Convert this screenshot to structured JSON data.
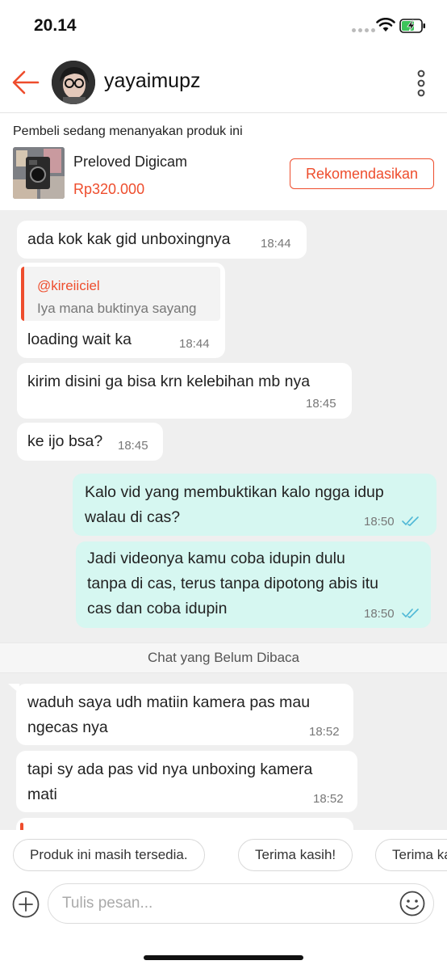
{
  "status_bar": {
    "time": "20.14"
  },
  "header": {
    "contact_name": "yayaimupz"
  },
  "product": {
    "notice": "Pembeli sedang menanyakan produk ini",
    "name": "Preloved Digicam",
    "price": "Rp320.000",
    "recommend_label": "Rekomendasikan"
  },
  "messages": [
    {
      "direction": "received",
      "text": "ada kok kak gid unboxingnya",
      "time": "18:44"
    },
    {
      "direction": "received",
      "quote_user": "@kireiiciel",
      "quote_text": "Iya mana buktinya sayang",
      "text": "loading wait ka",
      "time": "18:44"
    },
    {
      "direction": "received",
      "text": "kirim disini ga bisa krn kelebihan mb nya",
      "time": "18:45"
    },
    {
      "direction": "received",
      "text": "ke ijo bsa?",
      "time": "18:45"
    },
    {
      "direction": "sent",
      "lines": [
        "Kalo vid yang membuktikan kalo ngga idup",
        "walau di cas?"
      ],
      "time": "18:50",
      "read": true
    },
    {
      "direction": "sent",
      "lines": [
        "Jadi videonya kamu coba idupin dulu",
        "tanpa di cas, terus tanpa dipotong abis itu",
        "cas dan coba idupin"
      ],
      "time": "18:50",
      "read": true
    },
    {
      "direction": "received",
      "lines": [
        "waduh saya udh matiin kamera pas mau",
        "ngecas nya"
      ],
      "time": "18:52"
    },
    {
      "direction": "received",
      "lines": [
        "tapi sy ada pas vid nya unboxing kamera",
        "mati"
      ],
      "time": "18:52"
    }
  ],
  "unread_divider": "Chat yang Belum Dibaca",
  "quick_replies": [
    "Produk ini masih tersedia.",
    "Terima kasih!",
    "Terima kasih"
  ],
  "input": {
    "placeholder": "Tulis pesan..."
  },
  "colors": {
    "accent": "#ee4d2d",
    "sent_bubble": "#d6f7f1",
    "read_check": "#4fb8d6"
  }
}
